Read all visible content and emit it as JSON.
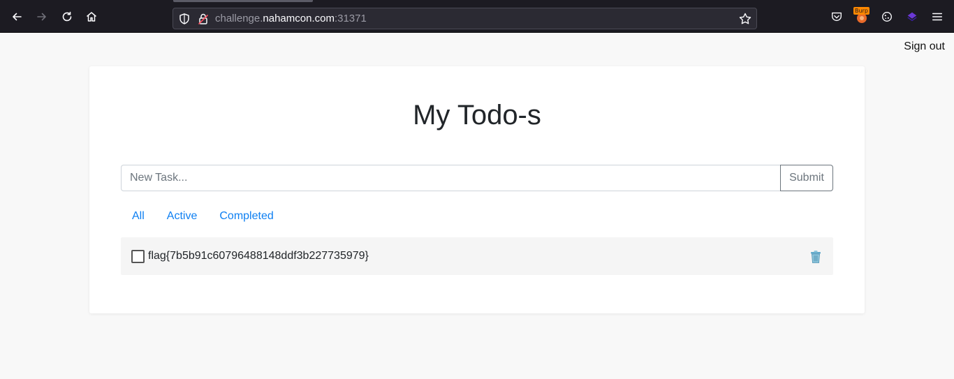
{
  "browser": {
    "url_prefix": "challenge.",
    "url_host": "nahamcon.com",
    "url_port": ":31371",
    "extensions": {
      "burp_badge": "Burp"
    }
  },
  "header": {
    "signout_label": "Sign out"
  },
  "main": {
    "title": "My Todo-s",
    "new_task_placeholder": "New Task...",
    "submit_label": "Submit",
    "filters": [
      "All",
      "Active",
      "Completed"
    ],
    "todos": [
      {
        "text": "flag{7b5b91c60796488148ddf3b227735979}",
        "completed": false
      }
    ]
  },
  "colors": {
    "accent_link": "#0d7ff2",
    "page_bg": "#f8f8f8",
    "chrome_bg": "#1c1b22"
  }
}
